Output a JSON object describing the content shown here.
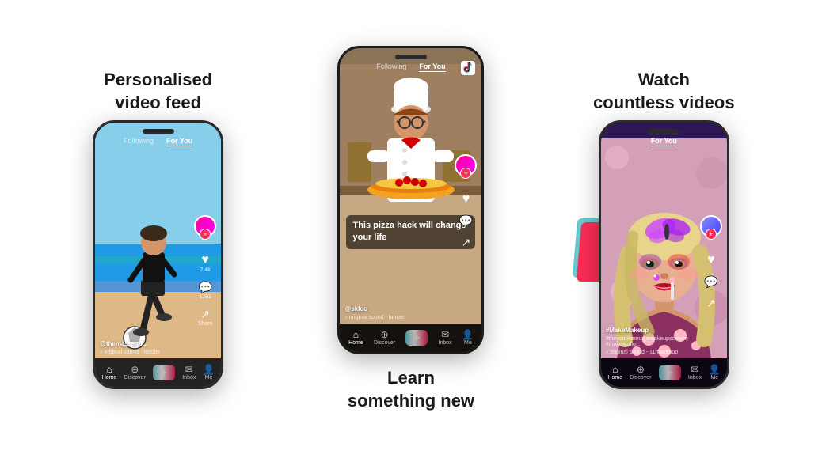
{
  "sections": {
    "left": {
      "title_line1": "Personalised",
      "title_line2": "video feed"
    },
    "center": {
      "title_line1": "Learn",
      "title_line2": "something new",
      "caption": "This pizza hack will change your life"
    },
    "right": {
      "title_line1": "Watch",
      "title_line2": "countless videos"
    }
  },
  "phone1": {
    "tab_following": "Following",
    "tab_for_you": "For You",
    "username": "@themasterof...",
    "sound": "♪ original sound - fancier",
    "nav": {
      "home": "Home",
      "discover": "Discover",
      "inbox": "Inbox",
      "me": "Me"
    }
  },
  "phone2": {
    "tab_following": "Following",
    "tab_for_you": "For You",
    "caption": "This pizza hack will change your life",
    "username": "@skloo",
    "sound": "♪ original sound - fancier",
    "nav": {
      "home": "Home",
      "discover": "Discover",
      "inbox": "Inbox",
      "me": "Me"
    }
  },
  "phone3": {
    "tab_for_you": "For You",
    "username": "#MakeMakeup",
    "tags": "#theycookmeup #makeupscience #makeandlo...",
    "sound": "♪ original sound - 11makeaup",
    "nav": {
      "home": "Home",
      "discover": "Discover",
      "inbox": "Inbox",
      "me": "Me"
    }
  }
}
